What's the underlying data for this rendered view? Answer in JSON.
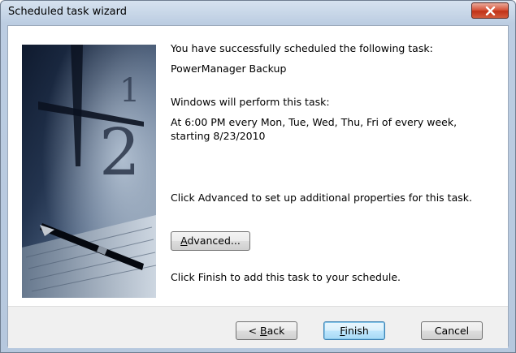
{
  "window": {
    "title": "Scheduled task wizard"
  },
  "content": {
    "success_line": "You have successfully scheduled the following task:",
    "task_name": "PowerManager Backup",
    "perform_line": "Windows will perform this task:",
    "schedule_line1": "At 6:00 PM every Mon, Tue, Wed, Thu, Fri of every week,",
    "schedule_line2": "starting 8/23/2010",
    "advanced_hint": "Click Advanced to set up additional properties for this task.",
    "finish_hint": "Click Finish to add this task to your schedule."
  },
  "buttons": {
    "advanced": {
      "mnemonic": "A",
      "rest": "dvanced..."
    },
    "back": {
      "prefix": "< ",
      "mnemonic": "B",
      "rest": "ack"
    },
    "finish": {
      "mnemonic": "F",
      "rest": "inish"
    },
    "cancel": "Cancel"
  },
  "icons": {
    "close": "close-icon",
    "wizard_image": "clock-and-pen-image"
  },
  "colors": {
    "titlebar": "#c7d6e8",
    "close_button": "#c9452a",
    "default_button_border": "#3c7fb1",
    "footer": "#f0f0f0"
  }
}
